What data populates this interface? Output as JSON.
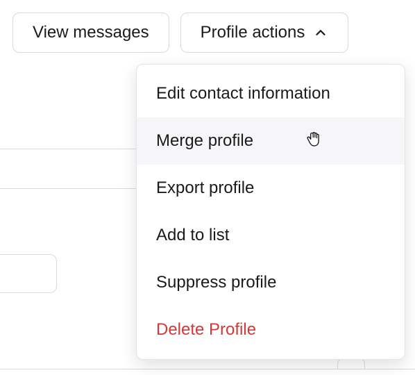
{
  "toolbar": {
    "view_messages_label": "View messages",
    "profile_actions_label": "Profile actions"
  },
  "dropdown": {
    "items": [
      {
        "label": "Edit contact information",
        "hovered": false,
        "danger": false
      },
      {
        "label": "Merge profile",
        "hovered": true,
        "danger": false
      },
      {
        "label": "Export profile",
        "hovered": false,
        "danger": false
      },
      {
        "label": "Add to list",
        "hovered": false,
        "danger": false
      },
      {
        "label": "Suppress profile",
        "hovered": false,
        "danger": false
      },
      {
        "label": "Delete Profile",
        "hovered": false,
        "danger": true
      }
    ]
  }
}
